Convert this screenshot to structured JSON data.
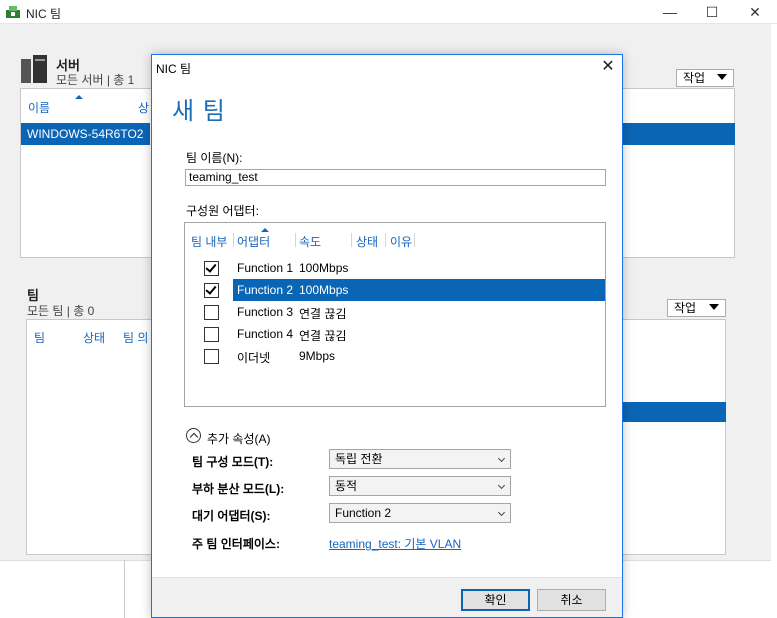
{
  "window": {
    "title": "NIC 팀"
  },
  "servers": {
    "title": "서버",
    "subtitle": "모든 서버 | 총 1",
    "tasks_label": "작업",
    "columns": [
      "이름",
      "상"
    ],
    "selected_server": "WINDOWS-54R6TO2"
  },
  "teams": {
    "title": "팀",
    "subtitle": "모든 팀 | 총 0",
    "tasks_label": "작업",
    "columns": [
      "팀",
      "상태",
      "팀 의"
    ]
  },
  "dialog": {
    "title": "NIC 팀",
    "heading": "새 팀",
    "team_name_label": "팀 이름(N):",
    "team_name_value": "teaming_test",
    "members_label": "구성원 어댑터:",
    "member_columns": [
      "팀 내부",
      "어댑터",
      "속도",
      "상태",
      "이유"
    ],
    "members": [
      {
        "checked": true,
        "adapter": "Function 1",
        "speed": "100Mbps",
        "selected": false
      },
      {
        "checked": true,
        "adapter": "Function 2",
        "speed": "100Mbps",
        "selected": true
      },
      {
        "checked": false,
        "adapter": "Function 3",
        "speed": "연결 끊김",
        "selected": false
      },
      {
        "checked": false,
        "adapter": "Function 4",
        "speed": "연결 끊김",
        "selected": false
      },
      {
        "checked": false,
        "adapter": "이더넷",
        "speed": "9Mbps",
        "selected": false
      }
    ],
    "additional_props_label": "추가 속성(A)",
    "teaming_mode_label": "팀 구성 모드(T):",
    "teaming_mode_value": "독립 전환",
    "load_balancing_label": "부하 분산 모드(L):",
    "load_balancing_value": "동적",
    "standby_label": "대기 어댑터(S):",
    "standby_value": "Function 2",
    "primary_if_label": "주 팀 인터페이스:",
    "primary_if_value": "teaming_test: 기본 VLAN",
    "ok_label": "확인",
    "cancel_label": "취소"
  },
  "colors": {
    "accent": "#0a66b5",
    "heading": "#1a6fb5",
    "link": "#1565c0"
  }
}
